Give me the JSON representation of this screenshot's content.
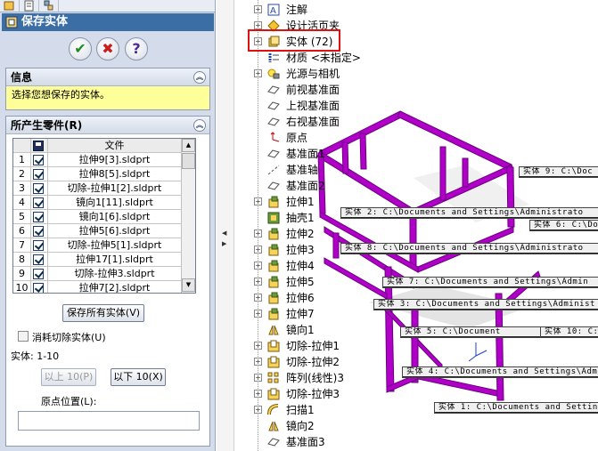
{
  "property_manager": {
    "title": "保存实体",
    "ok_symbol": "✔",
    "cancel_symbol": "✖",
    "help_symbol": "?",
    "info_section": {
      "header": "信息",
      "message": "选择您想保存的实体。"
    },
    "parts_section": {
      "header": "所产生零件(R)",
      "column_header": "文件",
      "rows": [
        {
          "num": "1",
          "file": "拉伸9[3].sldprt"
        },
        {
          "num": "2",
          "file": "拉伸8[5].sldprt"
        },
        {
          "num": "3",
          "file": "切除-拉伸1[2].sldprt"
        },
        {
          "num": "4",
          "file": "镜向1[11].sldprt"
        },
        {
          "num": "5",
          "file": "镜向1[6].sldprt"
        },
        {
          "num": "6",
          "file": "拉伸5[6].sldprt"
        },
        {
          "num": "7",
          "file": "切除-拉伸5[1].sldprt"
        },
        {
          "num": "8",
          "file": "拉伸17[1].sldprt"
        },
        {
          "num": "9",
          "file": "切除-拉伸3.sldprt"
        },
        {
          "num": "10",
          "file": "拉伸7[2].sldprt"
        }
      ],
      "save_all_button": "保存所有实体(V)",
      "consume_checkbox": "消耗切除实体(U)",
      "entities_label": "实体: 1-10",
      "prev_button": "以上 10(P)",
      "next_button": "以下 10(X)",
      "origin_label": "原点位置(L):"
    }
  },
  "feature_tree": {
    "items": [
      {
        "label": "注解",
        "icon": "annotation-icon",
        "expandable": true
      },
      {
        "label": "设计活页夹",
        "icon": "design-binder-icon",
        "expandable": true
      },
      {
        "label": "实体 (72)",
        "icon": "solid-bodies-icon",
        "expandable": true
      },
      {
        "label": "材质 <未指定>",
        "icon": "material-icon",
        "expandable": false
      },
      {
        "label": "光源与相机",
        "icon": "lights-camera-icon",
        "expandable": true
      },
      {
        "label": "前视基准面",
        "icon": "plane-icon",
        "expandable": false
      },
      {
        "label": "上视基准面",
        "icon": "plane-icon",
        "expandable": false
      },
      {
        "label": "右视基准面",
        "icon": "plane-icon",
        "expandable": false
      },
      {
        "label": "原点",
        "icon": "origin-icon",
        "expandable": false
      },
      {
        "label": "基准面1",
        "icon": "plane-icon",
        "expandable": false
      },
      {
        "label": "基准轴",
        "icon": "axis-icon",
        "expandable": false
      },
      {
        "label": "基准面2",
        "icon": "plane-icon",
        "expandable": false
      },
      {
        "label": "拉伸1",
        "icon": "extrude-icon",
        "expandable": true
      },
      {
        "label": "抽壳1",
        "icon": "shell-icon",
        "expandable": false
      },
      {
        "label": "拉伸2",
        "icon": "extrude-icon",
        "expandable": true
      },
      {
        "label": "拉伸3",
        "icon": "extrude-icon",
        "expandable": true
      },
      {
        "label": "拉伸4",
        "icon": "extrude-icon",
        "expandable": true
      },
      {
        "label": "拉伸5",
        "icon": "extrude-icon",
        "expandable": true
      },
      {
        "label": "拉伸6",
        "icon": "extrude-icon",
        "expandable": true
      },
      {
        "label": "拉伸7",
        "icon": "extrude-icon",
        "expandable": true
      },
      {
        "label": "镜向1",
        "icon": "mirror-icon",
        "expandable": false
      },
      {
        "label": "切除-拉伸1",
        "icon": "cut-extrude-icon",
        "expandable": true
      },
      {
        "label": "切除-拉伸2",
        "icon": "cut-extrude-icon",
        "expandable": true
      },
      {
        "label": "阵列(线性)3",
        "icon": "linear-pattern-icon",
        "expandable": true
      },
      {
        "label": "切除-拉伸3",
        "icon": "cut-extrude-icon",
        "expandable": true
      },
      {
        "label": "扫描1",
        "icon": "sweep-icon",
        "expandable": true
      },
      {
        "label": "镜向2",
        "icon": "mirror-icon",
        "expandable": false
      },
      {
        "label": "基准面3",
        "icon": "plane-icon",
        "expandable": false
      }
    ]
  },
  "viewport": {
    "callouts": [
      {
        "text": "实体  9:  C:\\Doc"
      },
      {
        "text": "实体  2:  C:\\Documents and Settings\\Administrato"
      },
      {
        "text": "实体  6:  C:\\Docu"
      },
      {
        "text": "实体  8:  C:\\Documents and Settings\\Administrato"
      },
      {
        "text": "实体  7:  C:\\Documents and Settings\\Admin"
      },
      {
        "text": "实体  3:  C:\\Documents and Settings\\Administ"
      },
      {
        "text": "实体  5:  C:\\Document"
      },
      {
        "text": "实体  10:  C:\\Doc"
      },
      {
        "text": "实体  4:  C:\\Documents and Settings\\Administ"
      },
      {
        "text": "实体  1:  C:\\Documents and Settings"
      }
    ],
    "colors": {
      "frame": "#b000c8",
      "frame_dark": "#6a0080",
      "highlight_box": "#e01010"
    }
  }
}
